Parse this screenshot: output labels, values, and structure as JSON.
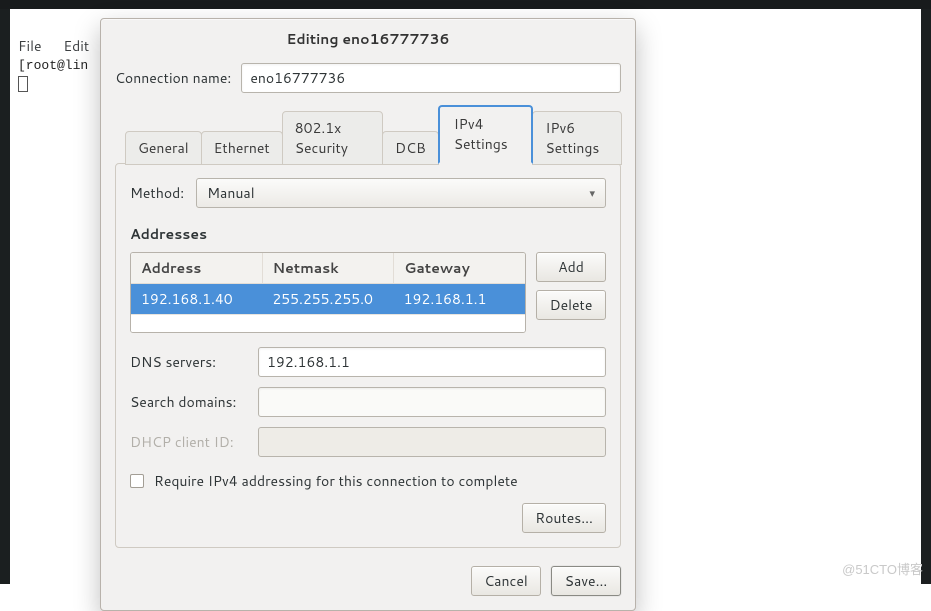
{
  "menubar": {
    "file": "File",
    "edit": "Edit"
  },
  "terminal": {
    "prompt": "[root@lin"
  },
  "dialog": {
    "title": "Editing eno16777736",
    "connection_name_label": "Connection name:",
    "connection_name": "eno16777736",
    "tabs": {
      "general": "General",
      "ethernet": "Ethernet",
      "security": "802.1x Security",
      "dcb": "DCB",
      "ipv4": "IPv4 Settings",
      "ipv6": "IPv6 Settings"
    },
    "method_label": "Method:",
    "method_value": "Manual",
    "addresses_label": "Addresses",
    "addr_headers": {
      "address": "Address",
      "netmask": "Netmask",
      "gateway": "Gateway"
    },
    "addr_rows": [
      {
        "address": "192.168.1.40",
        "netmask": "255.255.255.0",
        "gateway": "192.168.1.1"
      }
    ],
    "buttons": {
      "add": "Add",
      "delete": "Delete",
      "routes": "Routes…",
      "cancel": "Cancel",
      "save": "Save…"
    },
    "dns_label": "DNS servers:",
    "dns_value": "192.168.1.1",
    "search_label": "Search domains:",
    "search_value": "",
    "dhcp_label": "DHCP client ID:",
    "dhcp_value": "",
    "require_ipv4": "Require IPv4 addressing for this connection to complete"
  },
  "watermark": "@51CTO博客"
}
